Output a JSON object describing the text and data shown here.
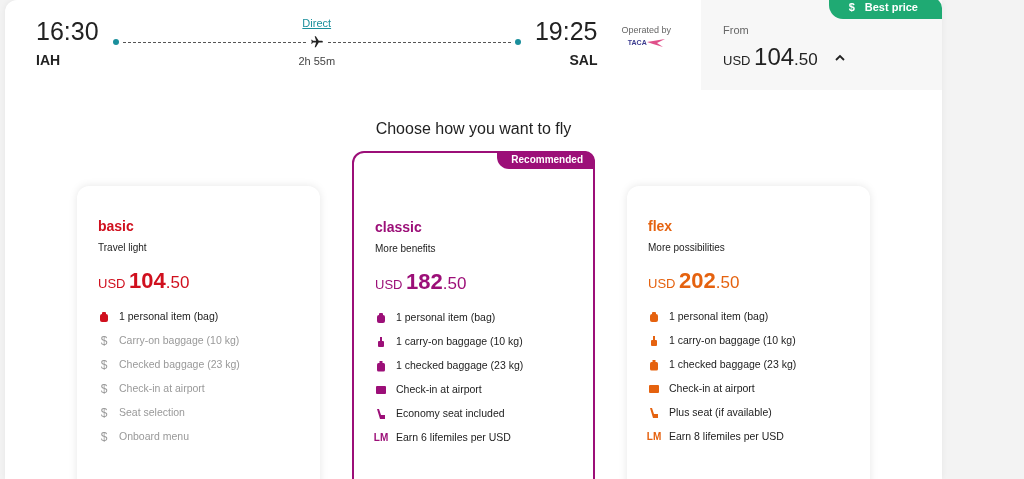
{
  "flight": {
    "departure_time": "16:30",
    "departure_airport": "IAH",
    "stops_link": "Direct",
    "duration": "2h 55m",
    "arrival_time": "19:25",
    "arrival_airport": "SAL",
    "operated_by": "Operated by",
    "operator_logo": "TACA"
  },
  "price_panel": {
    "badge_icon": "$",
    "badge": "Best price",
    "from": "From",
    "currency": "USD",
    "amount": "104",
    "cents": ".50",
    "expanded": true
  },
  "heading": "Choose how you want to fly",
  "fares": [
    {
      "name": "basic",
      "tagline": "Travel light",
      "currency": "USD",
      "amount": "104",
      "cents": ".50",
      "color": "#d0101e",
      "recommended": false,
      "features": [
        {
          "kind": "bag",
          "label": "1 personal item (bag)",
          "included": true
        },
        {
          "kind": "paid",
          "icon_text": "$",
          "label": "Carry-on baggage (10 kg)",
          "included": false
        },
        {
          "kind": "paid",
          "icon_text": "$",
          "label": "Checked baggage (23 kg)",
          "included": false
        },
        {
          "kind": "paid",
          "icon_text": "$",
          "label": "Check-in at airport",
          "included": false
        },
        {
          "kind": "paid",
          "icon_text": "$",
          "label": "Seat selection",
          "included": false
        },
        {
          "kind": "paid",
          "icon_text": "$",
          "label": "Onboard menu",
          "included": false
        }
      ]
    },
    {
      "name": "classic",
      "tagline": "More benefits",
      "currency": "USD",
      "amount": "182",
      "cents": ".50",
      "color": "#9c0f78",
      "recommended": true,
      "tag": "Recommended",
      "features": [
        {
          "kind": "bag",
          "label": "1 personal item (bag)",
          "included": true
        },
        {
          "kind": "carryon",
          "label": "1 carry-on baggage (10 kg)",
          "included": true
        },
        {
          "kind": "checked",
          "label": "1 checked baggage (23 kg)",
          "included": true
        },
        {
          "kind": "checkin",
          "label": "Check-in at airport",
          "included": true
        },
        {
          "kind": "seat",
          "label": "Economy seat included",
          "included": true
        },
        {
          "kind": "miles",
          "icon_text": "LM",
          "label": "Earn 6 lifemiles per USD",
          "included": true
        }
      ]
    },
    {
      "name": "flex",
      "tagline": "More possibilities",
      "currency": "USD",
      "amount": "202",
      "cents": ".50",
      "color": "#e5620f",
      "recommended": false,
      "features": [
        {
          "kind": "bag",
          "label": "1 personal item (bag)",
          "included": true
        },
        {
          "kind": "carryon",
          "label": "1 carry-on baggage (10 kg)",
          "included": true
        },
        {
          "kind": "checked",
          "label": "1 checked baggage (23 kg)",
          "included": true
        },
        {
          "kind": "checkin",
          "label": "Check-in at airport",
          "included": true
        },
        {
          "kind": "seat",
          "label": "Plus seat (if available)",
          "included": true
        },
        {
          "kind": "miles",
          "icon_text": "LM",
          "label": "Earn 8 lifemiles per USD",
          "included": true
        }
      ]
    }
  ]
}
